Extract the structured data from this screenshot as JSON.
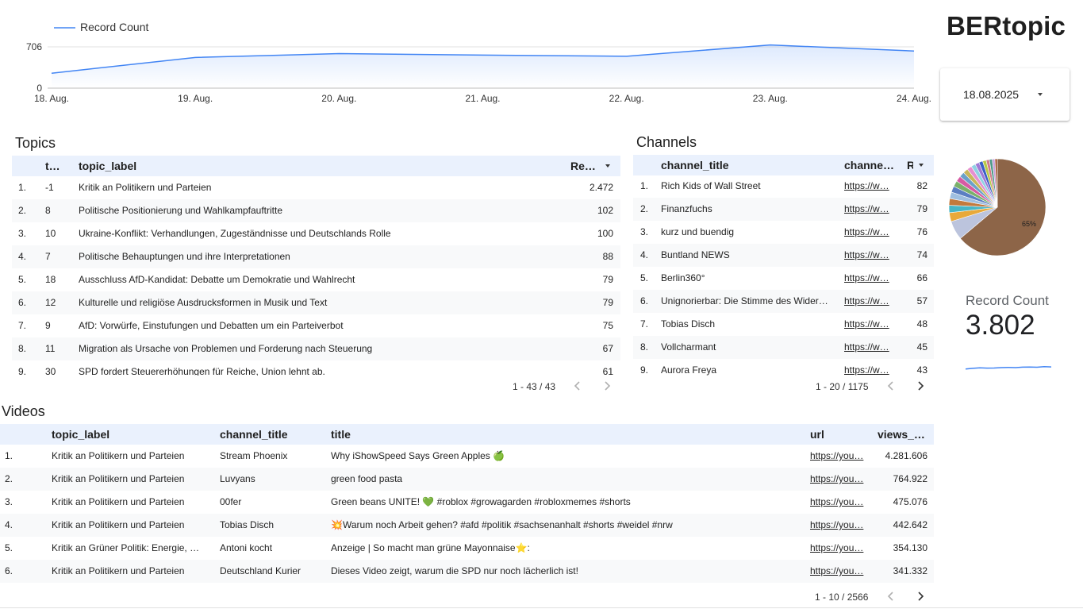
{
  "app": {
    "title": "BERtopic"
  },
  "date_filter": {
    "value": "18.08.2025"
  },
  "timeseries": {
    "legend_label": "Record Count",
    "color": "#4285f4"
  },
  "chart_data": [
    {
      "type": "area",
      "series": [
        {
          "name": "Record Count",
          "values": [
            255,
            525,
            590,
            565,
            545,
            738,
            635
          ]
        }
      ],
      "categories": [
        "18. Aug.",
        "19. Aug.",
        "20. Aug.",
        "21. Aug.",
        "22. Aug.",
        "23. Aug.",
        "24. Aug."
      ],
      "y_ticks": [
        "0",
        "706"
      ],
      "ylim": [
        0,
        706
      ],
      "grid": true,
      "legend": "top-left"
    },
    {
      "type": "pie",
      "slice_labels": [
        "65%"
      ],
      "values": [
        65,
        6.5,
        3,
        2.5,
        2.3,
        2.2,
        2.1,
        2,
        1.9,
        1.8,
        1.7,
        1.6,
        1.5,
        1.4,
        1.3,
        1.2,
        1.1,
        1,
        0.9,
        0.8
      ],
      "colors": [
        "#8d6548",
        "#bcc4dd",
        "#e8a93a",
        "#46b6c6",
        "#c27a3d",
        "#9fbfe0",
        "#5b7fc2",
        "#7ab06b",
        "#d65aa3",
        "#6aa0c9",
        "#c8b65b",
        "#e58fd0",
        "#8fd1e3",
        "#9f7ad6",
        "#3a5fc6",
        "#b9c847",
        "#d07b8a",
        "#4e9a8a",
        "#c9a0dc",
        "#a0522d"
      ]
    }
  ],
  "topics": {
    "title": "Topics",
    "columns": [
      "t…",
      "topic_label",
      "Re…"
    ],
    "rows": [
      {
        "n": "1.",
        "topic": "-1",
        "label": "Kritik an Politikern und Parteien",
        "count": "2.472"
      },
      {
        "n": "2.",
        "topic": "8",
        "label": "Politische Positionierung und Wahlkampfauftritte",
        "count": "102"
      },
      {
        "n": "3.",
        "topic": "10",
        "label": "Ukraine-Konflikt: Verhandlungen, Zugeständnisse und Deutschlands Rolle",
        "count": "100"
      },
      {
        "n": "4.",
        "topic": "7",
        "label": "Politische Behauptungen und ihre Interpretationen",
        "count": "88"
      },
      {
        "n": "5.",
        "topic": "18",
        "label": "Ausschluss AfD-Kandidat: Debatte um Demokratie und Wahlrecht",
        "count": "79"
      },
      {
        "n": "6.",
        "topic": "12",
        "label": "Kulturelle und religiöse Ausdrucksformen in Musik und Text",
        "count": "79"
      },
      {
        "n": "7.",
        "topic": "9",
        "label": "AfD: Vorwürfe, Einstufungen und Debatten um ein Parteiverbot",
        "count": "75"
      },
      {
        "n": "8.",
        "topic": "11",
        "label": "Migration als Ursache von Problemen und Forderung nach Steuerung",
        "count": "67"
      },
      {
        "n": "9.",
        "topic": "30",
        "label": "SPD fordert Steuererhöhungen für Reiche, Union lehnt ab.",
        "count": "61"
      }
    ],
    "pager": "1 - 43 / 43"
  },
  "channels": {
    "title": "Channels",
    "columns": [
      "channel_title",
      "channe…",
      "R"
    ],
    "rows": [
      {
        "n": "1.",
        "title": "Rich Kids of Wall Street",
        "url": "https://w…",
        "count": "82"
      },
      {
        "n": "2.",
        "title": "Finanzfuchs",
        "url": "https://w…",
        "count": "79"
      },
      {
        "n": "3.",
        "title": "kurz und buendig",
        "url": "https://w…",
        "count": "76"
      },
      {
        "n": "4.",
        "title": "Buntland NEWS",
        "url": "https://w…",
        "count": "74"
      },
      {
        "n": "5.",
        "title": "Berlin360°",
        "url": "https://w…",
        "count": "66"
      },
      {
        "n": "6.",
        "title": "Unignorierbar: Die Stimme des Wider…",
        "url": "https://w…",
        "count": "57"
      },
      {
        "n": "7.",
        "title": "Tobias Disch",
        "url": "https://w…",
        "count": "48"
      },
      {
        "n": "8.",
        "title": "Vollcharmant",
        "url": "https://w…",
        "count": "45"
      },
      {
        "n": "9.",
        "title": "Aurora Freya",
        "url": "https://w…",
        "count": "43"
      }
    ],
    "pager": "1 - 20 / 1175"
  },
  "scorecard": {
    "label": "Record Count",
    "value": "3.802",
    "spark_values": [
      0.2,
      0.35,
      0.45,
      0.4,
      0.42,
      0.5,
      0.55,
      0.5,
      0.6,
      0.62,
      0.58,
      0.7,
      0.65
    ]
  },
  "videos": {
    "title": "Videos",
    "columns": [
      "topic_label",
      "channel_title",
      "title",
      "url",
      "views_…"
    ],
    "rows": [
      {
        "n": "1.",
        "topic": "Kritik an Politikern und Parteien",
        "channel": "Stream Phoenix",
        "title": "Why iShowSpeed Says Green Apples 🍏",
        "url": "https://you…",
        "views": "4.281.606"
      },
      {
        "n": "2.",
        "topic": "Kritik an Politikern und Parteien",
        "channel": "Luvyans",
        "title": "green food pasta",
        "url": "https://you…",
        "views": "764.922"
      },
      {
        "n": "3.",
        "topic": "Kritik an Politikern und Parteien",
        "channel": "00fer",
        "title": "Green beans UNITE! 💚 #roblox #growagarden #robloxmemes #shorts",
        "url": "https://you…",
        "views": "475.076"
      },
      {
        "n": "4.",
        "topic": "Kritik an Politikern und Parteien",
        "channel": "Tobias Disch",
        "title": "💥Warum noch Arbeit gehen? #afd #politik #sachsenanhalt #shorts #weidel #nrw",
        "url": "https://you…",
        "views": "442.642"
      },
      {
        "n": "5.",
        "topic": "Kritik an Grüner Politik: Energie, …",
        "channel": "Antoni kocht",
        "title": "Anzeige | So macht man grüne Mayonnaise⭐:",
        "url": "https://you…",
        "views": "354.130"
      },
      {
        "n": "6.",
        "topic": "Kritik an Politikern und Parteien",
        "channel": "Deutschland Kurier",
        "title": "Dieses Video zeigt, warum die SPD nur noch lächerlich ist!",
        "url": "https://you…",
        "views": "341.332"
      }
    ],
    "pager": "1 - 10 / 2566"
  }
}
